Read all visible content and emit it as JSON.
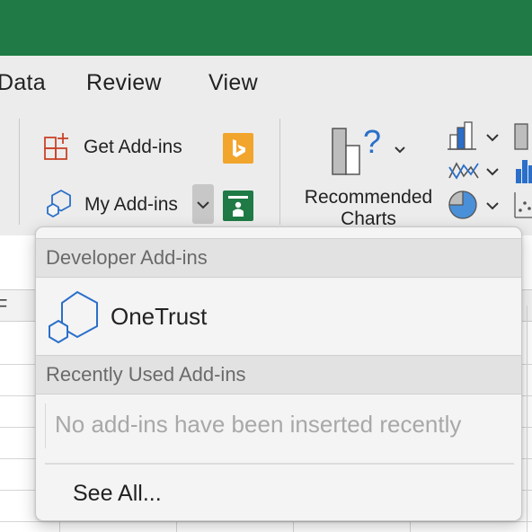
{
  "menu": {
    "items": [
      {
        "label": "Data"
      },
      {
        "label": "Review"
      },
      {
        "label": "View"
      }
    ]
  },
  "ribbon": {
    "get_addins_label": "Get Add-ins",
    "my_addins_label": "My Add-ins",
    "recommended_charts_line1": "Recommended",
    "recommended_charts_line2": "Charts"
  },
  "dropdown": {
    "developer_header": "Developer Add-ins",
    "onetrust_label": "OneTrust",
    "recent_header": "Recently Used Add-ins",
    "empty_message": "No add-ins have been inserted recently",
    "see_all_label": "See All..."
  },
  "sheet": {
    "column_partial_label": "F"
  },
  "colors": {
    "titlebar": "#1f7a45",
    "accent_blue": "#2a6fc9",
    "bing_orange": "#f2a52c",
    "people_green": "#1f7a45"
  },
  "icons": [
    "add-store-icon",
    "bing-icon",
    "hexagon-addin-icon",
    "chevron-down-icon",
    "people-graph-icon",
    "recommended-charts-icon",
    "column-chart-icon",
    "line-chart-icon",
    "pie-chart-icon",
    "onetrust-icon"
  ]
}
